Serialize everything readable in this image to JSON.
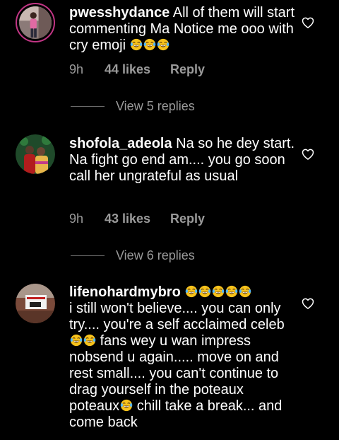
{
  "comments": [
    {
      "username": "pwesshydance",
      "text": "All of them will start commenting Ma Notice me ooo with cry emoji",
      "emojis_after": [
        "laughing-tears-emoji",
        "laughing-tears-emoji",
        "laughing-tears-emoji"
      ],
      "time": "9h",
      "likes": "44 likes",
      "reply_label": "Reply",
      "view_replies": "View 5 replies"
    },
    {
      "username": "shofola_adeola",
      "text": "Na so he dey start. Na fight go end am.... you go soon call her ungrateful as usual",
      "time": "9h",
      "likes": "43 likes",
      "reply_label": "Reply",
      "view_replies": "View 6 replies"
    },
    {
      "username": "lifenohardmybro",
      "text_part1": "i still won't believe.... you can only try.... you're a self acclaimed celeb",
      "text_part2": "fans wey u wan impress nobsend u again..... move on and rest small.... you can't continue to drag yourself in the poteaux poteaux",
      "text_part3": "chill take a break... and come back"
    }
  ],
  "colors": {
    "background": "#000000",
    "text": "#ffffff",
    "muted": "#9a9a9a",
    "story_ring": "#c13584",
    "emoji_face": "#f7c21b"
  }
}
